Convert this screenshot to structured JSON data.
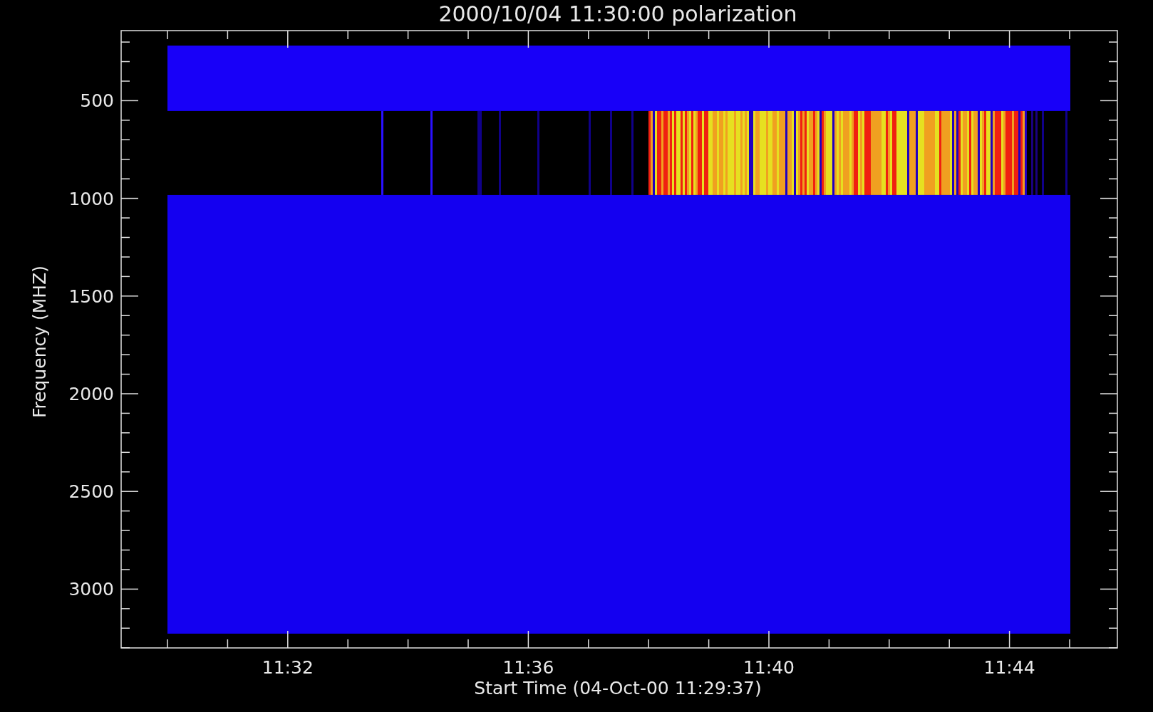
{
  "title": "2000/10/04 11:30:00 polarization",
  "y_axis": {
    "label": "Frequency (MHZ)",
    "tick_labels": [
      "500",
      "1000",
      "1500",
      "2000",
      "2500",
      "3000"
    ]
  },
  "x_axis": {
    "label": "Start Time (04-Oct-00 11:29:37)",
    "tick_labels": [
      "11:32",
      "11:36",
      "11:40",
      "11:44"
    ]
  }
}
